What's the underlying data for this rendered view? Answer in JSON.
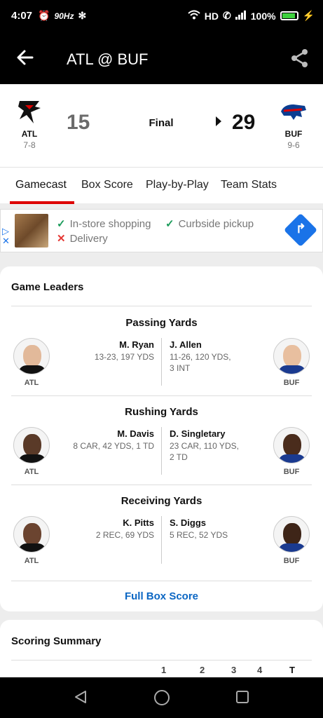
{
  "status_bar": {
    "time": "4:07",
    "refresh": "90Hz",
    "network": "HD",
    "battery": "100%"
  },
  "app_bar": {
    "title": "ATL @ BUF"
  },
  "game": {
    "status": "Final",
    "away": {
      "abbr": "ATL",
      "record": "7-8",
      "score": "15"
    },
    "home": {
      "abbr": "BUF",
      "record": "9-6",
      "score": "29"
    }
  },
  "tabs": [
    "Gamecast",
    "Box Score",
    "Play-by-Play",
    "Team Stats"
  ],
  "ad": {
    "line1_a": "In-store shopping",
    "line1_b": "Curbside pickup",
    "line2": "Delivery"
  },
  "leaders": {
    "title": "Game Leaders",
    "blocks": [
      {
        "category": "Passing Yards",
        "away": {
          "name": "M. Ryan",
          "stats": "13-23, 197 YDS",
          "team": "ATL"
        },
        "home": {
          "name": "J. Allen",
          "stats": "11-26, 120 YDS,\n3 INT",
          "team": "BUF"
        }
      },
      {
        "category": "Rushing Yards",
        "away": {
          "name": "M. Davis",
          "stats": "8 CAR, 42 YDS, 1 TD",
          "team": "ATL"
        },
        "home": {
          "name": "D. Singletary",
          "stats": "23 CAR, 110 YDS,\n2 TD",
          "team": "BUF"
        }
      },
      {
        "category": "Receiving Yards",
        "away": {
          "name": "K. Pitts",
          "stats": "2 REC, 69 YDS",
          "team": "ATL"
        },
        "home": {
          "name": "S. Diggs",
          "stats": "5 REC, 52 YDS",
          "team": "BUF"
        }
      }
    ],
    "full_box_score": "Full Box Score"
  },
  "scoring": {
    "title": "Scoring Summary",
    "columns": [
      "1",
      "2",
      "3",
      "4",
      "T"
    ]
  }
}
